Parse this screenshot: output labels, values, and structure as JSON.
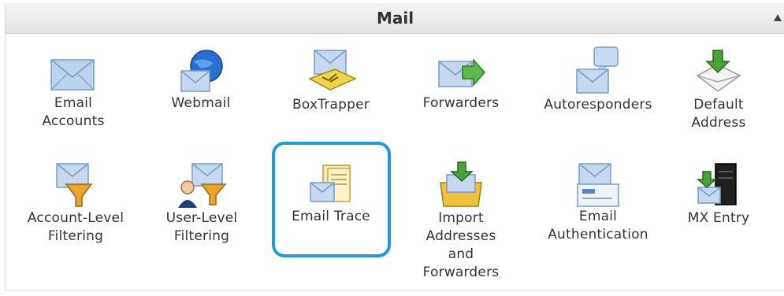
{
  "panel": {
    "title": "Mail"
  },
  "items": [
    {
      "label_lines": [
        "Email",
        "Accounts"
      ],
      "icon": "email-accounts-icon"
    },
    {
      "label_lines": [
        "Webmail"
      ],
      "icon": "webmail-icon"
    },
    {
      "label_lines": [
        "BoxTrapper"
      ],
      "icon": "boxtrapper-icon"
    },
    {
      "label_lines": [
        "Forwarders"
      ],
      "icon": "forwarders-icon"
    },
    {
      "label_lines": [
        "Autoresponders"
      ],
      "icon": "autoresponders-icon"
    },
    {
      "label_lines": [
        "Default",
        "Address"
      ],
      "icon": "default-address-icon"
    },
    {
      "label_lines": [
        "Account-Level",
        "Filtering"
      ],
      "icon": "account-filter-icon"
    },
    {
      "label_lines": [
        "User-Level",
        "Filtering"
      ],
      "icon": "user-filter-icon"
    },
    {
      "label_lines": [
        "Email Trace"
      ],
      "icon": "email-trace-icon"
    },
    {
      "label_lines": [
        "Import",
        "Addresses",
        "and",
        "Forwarders"
      ],
      "icon": "import-icon"
    },
    {
      "label_lines": [
        "Email",
        "Authentication"
      ],
      "icon": "email-auth-icon"
    },
    {
      "label_lines": [
        "MX Entry"
      ],
      "icon": "mx-entry-icon"
    }
  ],
  "colors": {
    "highlight": "#1e9bd8",
    "envelope": "#a9c4e6",
    "arrow_green": "#4aa33a"
  }
}
